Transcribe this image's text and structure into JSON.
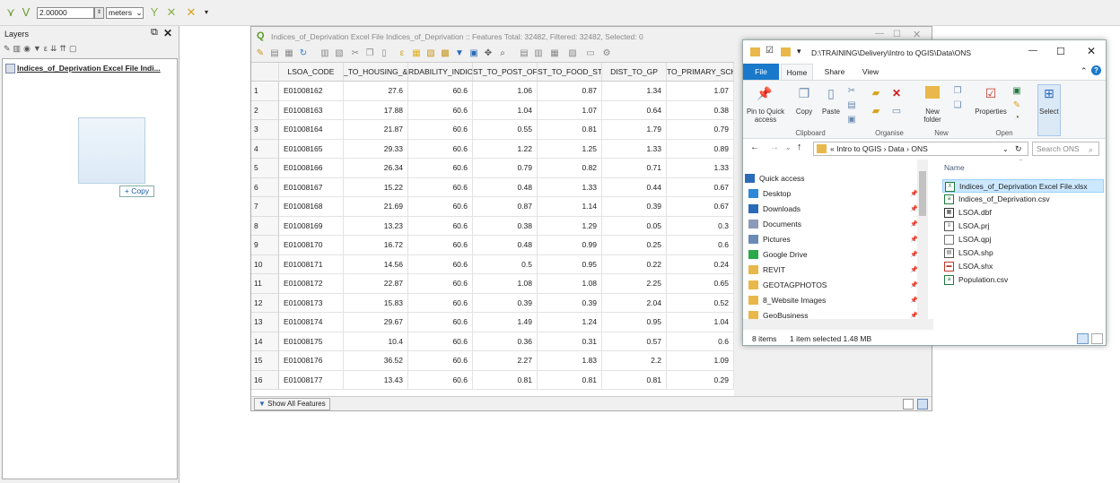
{
  "toolbar": {
    "tolerance_value": "2.00000",
    "unit_value": "meters"
  },
  "layers_panel": {
    "title": "Layers",
    "layer_name": "Indices_of_Deprivation Excel File Indi...",
    "copy_tooltip": "+ Copy"
  },
  "attribute_table": {
    "title": "Indices_of_Deprivation Excel File Indices_of_Deprivation :: Features Total: 32482, Filtered: 32482, Selected: 0",
    "columns": [
      "LSOA_CODE",
      "_TO_HOUSING_&",
      "RDABILITY_INDIC",
      "ST_TO_POST_OFFI",
      "ST_TO_FOOD_STO",
      "DIST_TO_GP",
      "TO_PRIMARY_SCH"
    ],
    "rows": [
      {
        "n": "1",
        "c": [
          "E01008162",
          "27.6",
          "60.6",
          "1.06",
          "0.87",
          "1.34",
          "1.07"
        ]
      },
      {
        "n": "2",
        "c": [
          "E01008163",
          "17.88",
          "60.6",
          "1.04",
          "1.07",
          "0.64",
          "0.38"
        ]
      },
      {
        "n": "3",
        "c": [
          "E01008164",
          "21.87",
          "60.6",
          "0.55",
          "0.81",
          "1.79",
          "0.79"
        ]
      },
      {
        "n": "4",
        "c": [
          "E01008165",
          "29.33",
          "60.6",
          "1.22",
          "1.25",
          "1.33",
          "0.89"
        ]
      },
      {
        "n": "5",
        "c": [
          "E01008166",
          "26.34",
          "60.6",
          "0.79",
          "0.82",
          "0.71",
          "1.33"
        ]
      },
      {
        "n": "6",
        "c": [
          "E01008167",
          "15.22",
          "60.6",
          "0.48",
          "1.33",
          "0.44",
          "0.67"
        ]
      },
      {
        "n": "7",
        "c": [
          "E01008168",
          "21.69",
          "60.6",
          "0.87",
          "1.14",
          "0.39",
          "0.67"
        ]
      },
      {
        "n": "8",
        "c": [
          "E01008169",
          "13.23",
          "60.6",
          "0.38",
          "1.29",
          "0.05",
          "0.3"
        ]
      },
      {
        "n": "9",
        "c": [
          "E01008170",
          "16.72",
          "60.6",
          "0.48",
          "0.99",
          "0.25",
          "0.6"
        ]
      },
      {
        "n": "10",
        "c": [
          "E01008171",
          "14.56",
          "60.6",
          "0.5",
          "0.95",
          "0.22",
          "0.24"
        ]
      },
      {
        "n": "11",
        "c": [
          "E01008172",
          "22.87",
          "60.6",
          "1.08",
          "1.08",
          "2.25",
          "0.65"
        ]
      },
      {
        "n": "12",
        "c": [
          "E01008173",
          "15.83",
          "60.6",
          "0.39",
          "0.39",
          "2.04",
          "0.52"
        ]
      },
      {
        "n": "13",
        "c": [
          "E01008174",
          "29.67",
          "60.6",
          "1.49",
          "1.24",
          "0.95",
          "1.04"
        ]
      },
      {
        "n": "14",
        "c": [
          "E01008175",
          "10.4",
          "60.6",
          "0.36",
          "0.31",
          "0.57",
          "0.6"
        ]
      },
      {
        "n": "15",
        "c": [
          "E01008176",
          "36.52",
          "60.6",
          "2.27",
          "1.83",
          "2.2",
          "1.09"
        ]
      },
      {
        "n": "16",
        "c": [
          "E01008177",
          "13.43",
          "60.6",
          "0.81",
          "0.81",
          "0.81",
          "0.29"
        ]
      }
    ],
    "show_all_label": "Show All Features"
  },
  "explorer": {
    "title": "D:\\TRAINING\\Delivery\\Intro to QGIS\\Data\\ONS",
    "tabs": [
      "File",
      "Home",
      "Share",
      "View"
    ],
    "ribbon": {
      "pin": "Pin to Quick access",
      "copy": "Copy",
      "paste": "Paste",
      "new_folder": "New folder",
      "properties": "Properties",
      "select": "Select",
      "groups": [
        "Clipboard",
        "Organise",
        "New",
        "Open"
      ]
    },
    "breadcrumb": [
      "«",
      "Intro to QGIS",
      "›",
      "Data",
      "›",
      "ONS"
    ],
    "search_placeholder": "Search ONS",
    "nav": [
      {
        "label": "Quick access",
        "icon": "star-icon"
      },
      {
        "label": "Desktop",
        "icon": "desktop-icon"
      },
      {
        "label": "Downloads",
        "icon": "download-icon"
      },
      {
        "label": "Documents",
        "icon": "documents-icon"
      },
      {
        "label": "Pictures",
        "icon": "pictures-icon"
      },
      {
        "label": "Google Drive",
        "icon": "google-drive-icon"
      },
      {
        "label": "REVIT",
        "icon": "folder-icon"
      },
      {
        "label": "GEOTAGPHOTOS",
        "icon": "folder-icon"
      },
      {
        "label": "8_Website Images",
        "icon": "folder-icon"
      },
      {
        "label": "GeoBusiness",
        "icon": "folder-icon"
      }
    ],
    "files_header": "Name",
    "files": [
      {
        "label": "Indices_of_Deprivation Excel File.xlsx",
        "icon": "excel-file-icon"
      },
      {
        "label": "Indices_of_Deprivation.csv",
        "icon": "csv-file-icon"
      },
      {
        "label": "LSOA.dbf",
        "icon": "dbf-file-icon"
      },
      {
        "label": "LSOA.prj",
        "icon": "prj-file-icon"
      },
      {
        "label": "LSOA.qpj",
        "icon": "qpj-file-icon"
      },
      {
        "label": "LSOA.shp",
        "icon": "shp-file-icon"
      },
      {
        "label": "LSOA.shx",
        "icon": "shx-file-icon"
      },
      {
        "label": "Population.csv",
        "icon": "csv-file-icon"
      }
    ],
    "status_items": "8 items",
    "status_selected": "1 item selected  1.48 MB"
  },
  "colors": {
    "accent": "#1979ca",
    "selection": "#cce8ff",
    "folder": "#e8b84a",
    "excel": "#1d7a3e"
  }
}
